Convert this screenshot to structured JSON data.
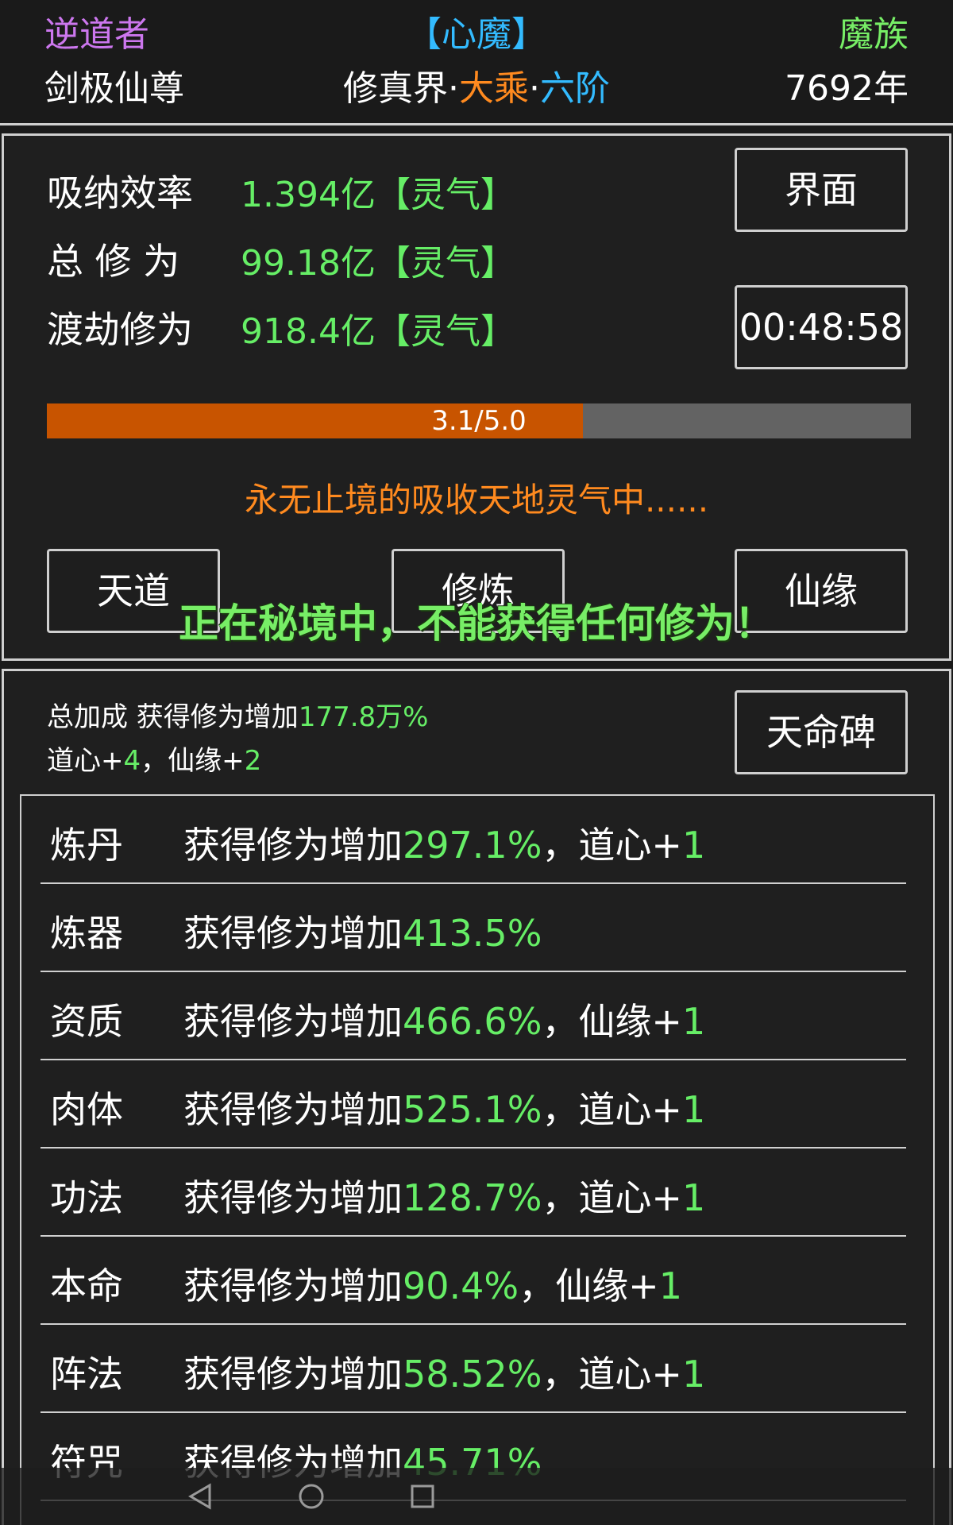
{
  "header": {
    "role": "逆道者",
    "status_title": "【心魔】",
    "race": "魔族",
    "player_name": "剑极仙尊",
    "realm_world": "修真界",
    "sep1": "·",
    "realm_stage": "大乘",
    "sep2": "·",
    "realm_level": "六阶",
    "age": "7692年"
  },
  "stats": {
    "absorb_label": "吸纳效率",
    "absorb_value": "1.394亿【灵气】",
    "total_label": "总 修 为",
    "total_value": "99.18亿【灵气】",
    "tribulation_label": "渡劫修为",
    "tribulation_value": "918.4亿【灵气】"
  },
  "buttons": {
    "ui": "界面",
    "timer": "00:48:58",
    "tiandao": "天道",
    "xiulian": "修炼",
    "xianyuan": "仙缘",
    "stele": "天命碑"
  },
  "progress": {
    "label": "3.1/5.0",
    "current": 3.1,
    "max": 5.0
  },
  "status_message": "永无止境的吸收天地灵气中......",
  "toast": "正在秘境中，不能获得任何修为！",
  "bonus": {
    "prefix": "总加成 获得修为增加",
    "value": "177.8万%",
    "daoxin_label": "道心+",
    "daoxin_value": "4",
    "comma": "，",
    "xianyuan_label": "仙缘+",
    "xianyuan_value": "2"
  },
  "rows": [
    {
      "name": "炼丹",
      "prefix": "获得修为增加",
      "pct": "297.1%",
      "extra_label": "，道心+",
      "extra_value": "1"
    },
    {
      "name": "炼器",
      "prefix": "获得修为增加",
      "pct": "413.5%",
      "extra_label": "",
      "extra_value": ""
    },
    {
      "name": "资质",
      "prefix": "获得修为增加",
      "pct": "466.6%",
      "extra_label": "，仙缘+",
      "extra_value": "1"
    },
    {
      "name": "肉体",
      "prefix": "获得修为增加",
      "pct": "525.1%",
      "extra_label": "，道心+",
      "extra_value": "1"
    },
    {
      "name": "功法",
      "prefix": "获得修为增加",
      "pct": "128.7%",
      "extra_label": "，道心+",
      "extra_value": "1"
    },
    {
      "name": "本命",
      "prefix": "获得修为增加",
      "pct": "90.4%",
      "extra_label": "，仙缘+",
      "extra_value": "1"
    },
    {
      "name": "阵法",
      "prefix": "获得修为增加",
      "pct": "58.52%",
      "extra_label": "，道心+",
      "extra_value": "1"
    },
    {
      "name": "符咒",
      "prefix": "获得修为增加",
      "pct": "45.71%",
      "extra_label": "",
      "extra_value": ""
    }
  ],
  "icons": {
    "back": "back-triangle-icon",
    "home": "home-circle-icon",
    "recent": "recent-square-icon"
  },
  "colors": {
    "green": "#66ee66",
    "orange": "#ff8a1f",
    "blue": "#33bbff",
    "purple": "#cc77ee",
    "progress_fill": "#c85400"
  }
}
